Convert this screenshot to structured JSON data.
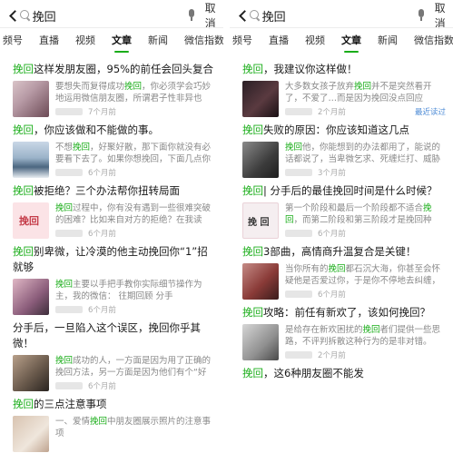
{
  "left": {
    "search": {
      "query": "挽回",
      "cancel": "取消"
    },
    "tabs": [
      "频号",
      "直播",
      "视频",
      "文章",
      "新闻",
      "微信指数"
    ],
    "active_tab": "文章",
    "items": [
      {
        "title_hl": "挽回",
        "title_rest": "这样发朋友圈，95%的前任会回头复合",
        "desc_pre": "要想失而复得成功",
        "desc_hl": "挽回",
        "desc_post": "，你必须学会巧妙地运用微信朋友圈，所谓君子性非异也",
        "time": "7个月前"
      },
      {
        "title_hl": "挽回",
        "title_rest": "，你应该做和不能做的事。",
        "desc_pre": "不想",
        "desc_hl": "挽回",
        "desc_post": "，好聚好散，那下面你就没有必要看下去了。如果你想挽回，下面几点你",
        "time": "6个月前"
      },
      {
        "title_hl": "挽回",
        "title_rest": "被拒绝？三个办法帮你扭转局面",
        "desc_pre": "",
        "desc_hl": "挽回",
        "desc_post": "过程中，你有没有遇到一些很难突破的困难？比如来自对方的拒绝？在我读",
        "time": "6个月前"
      },
      {
        "title_hl": "挽回",
        "title_rest": "别卑微，让冷漠的他主动挽回你“1”招就够",
        "desc_pre": "",
        "desc_hl": "挽回",
        "desc_post": "主要以手把手教你实际细节操作为主，我的微信：          往期回顾 分手",
        "time": "6个月前"
      },
      {
        "title_hl": "",
        "title_rest": "分手后，一旦陷入这个误区，挽回你乎其微！",
        "desc_pre": "",
        "desc_hl": "挽回",
        "desc_post": "成功的人，一方面是因为用了正确的挽回方法，另一方面是因为他们有个“好",
        "time": "6个月前"
      },
      {
        "title_hl": "挽回",
        "title_rest": "的三点注意事项",
        "desc_pre": "一、爱情",
        "desc_hl": "挽回",
        "desc_post": "中朋友圈展示照片的注意事项",
        "time": ""
      }
    ]
  },
  "right": {
    "search": {
      "query": "挽回",
      "cancel": "取消"
    },
    "tabs": [
      "频号",
      "直播",
      "视频",
      "文章",
      "新闻",
      "微信指数"
    ],
    "active_tab": "文章",
    "items": [
      {
        "title_hl": "挽回",
        "title_rest": "，我建议你这样做！",
        "desc_pre": "大多数女孩子放弃",
        "desc_hl": "挽回",
        "desc_post": "并不是突然看开了，不爱了…而是因为挽回没点回应",
        "time": "2个月前",
        "badge": "最近读过"
      },
      {
        "title_hl": "挽回",
        "title_rest": "失败的原因：你应该知道这几点",
        "desc_pre": "",
        "desc_hl": "挽回",
        "desc_post": "他，你能想到的办法都用了，能说的话都说了，当卑微乞求、死缠烂打、威胁",
        "time": "3个月前"
      },
      {
        "title_hl": "挽回",
        "title_rest": "| 分手后的最佳挽回时间是什么时候？",
        "desc_pre": "第一个阶段和最后一个阶段都不适合",
        "desc_hl": "挽回",
        "desc_post": "，而第二阶段和第三阶段才是挽回种",
        "time": "6个月前"
      },
      {
        "title_hl": "挽回",
        "title_rest": "3部曲，高情商升温复合是关键！",
        "desc_pre": "当你所有的",
        "desc_hl": "挽回",
        "desc_post": "都石沉大海，你甚至会怀疑他是否爱过你，于是你不停地去纠缠，",
        "time": "6个月前"
      },
      {
        "title_hl": "挽回",
        "title_rest": "攻略：前任有新欢了，该如何挽回？",
        "desc_pre": "是给存在新欢困扰的",
        "desc_hl": "挽回",
        "desc_post": "者们提供一些思路，不评判拆散这种行为的是非对错。",
        "time": "2个月前"
      },
      {
        "title_hl": "挽回",
        "title_rest": "，这6种朋友圈不能发",
        "desc_pre": "",
        "desc_hl": "",
        "desc_post": "",
        "time": ""
      }
    ]
  }
}
